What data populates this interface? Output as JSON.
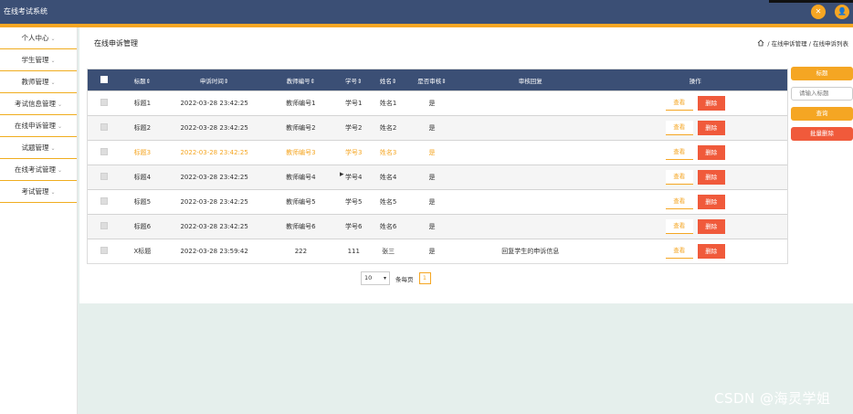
{
  "app": {
    "title": "在线考试系统"
  },
  "header": {
    "close_icon": "close-icon",
    "user_icon": "user-icon"
  },
  "sidebar": {
    "items": [
      {
        "label": "个人中心"
      },
      {
        "label": "学生管理"
      },
      {
        "label": "教师管理"
      },
      {
        "label": "考试信息管理"
      },
      {
        "label": "在线申诉管理"
      },
      {
        "label": "试题管理"
      },
      {
        "label": "在线考试管理"
      },
      {
        "label": "考试管理"
      }
    ]
  },
  "page": {
    "title": "在线申诉管理",
    "breadcrumb": [
      "在线申诉管理",
      "在线申诉列表"
    ],
    "breadcrumb_sep": "/"
  },
  "table": {
    "columns": [
      "标题",
      "申诉时间",
      "教师编号",
      "学号",
      "姓名",
      "是否审核",
      "审核回复",
      "操作"
    ],
    "sort_marker": "⇕",
    "rows": [
      {
        "title": "标题1",
        "time": "2022-03-28 23:42:25",
        "teacher": "教师编号1",
        "student_no": "学号1",
        "name": "姓名1",
        "reviewed": "是",
        "reply": ""
      },
      {
        "title": "标题2",
        "time": "2022-03-28 23:42:25",
        "teacher": "教师编号2",
        "student_no": "学号2",
        "name": "姓名2",
        "reviewed": "是",
        "reply": ""
      },
      {
        "title": "标题3",
        "time": "2022-03-28 23:42:25",
        "teacher": "教师编号3",
        "student_no": "学号3",
        "name": "姓名3",
        "reviewed": "是",
        "reply": ""
      },
      {
        "title": "标题4",
        "time": "2022-03-28 23:42:25",
        "teacher": "教师编号4",
        "student_no": "学号4",
        "name": "姓名4",
        "reviewed": "是",
        "reply": ""
      },
      {
        "title": "标题5",
        "time": "2022-03-28 23:42:25",
        "teacher": "教师编号5",
        "student_no": "学号5",
        "name": "姓名5",
        "reviewed": "是",
        "reply": ""
      },
      {
        "title": "标题6",
        "time": "2022-03-28 23:42:25",
        "teacher": "教师编号6",
        "student_no": "学号6",
        "name": "姓名6",
        "reviewed": "是",
        "reply": ""
      },
      {
        "title": "X标题",
        "time": "2022-03-28 23:59:42",
        "teacher": "222",
        "student_no": "111",
        "name": "张三",
        "reviewed": "是",
        "reply": "回复学生的申诉信息"
      }
    ],
    "actions": {
      "view": "查看",
      "delete": "删除"
    }
  },
  "pagination": {
    "page_size": "10",
    "page_size_label": "条每页",
    "current_page": "1"
  },
  "tools": {
    "label_button": "标题",
    "search_placeholder": "请输入标题",
    "search_button": "查询",
    "batch_delete": "批量删除"
  },
  "watermark": "CSDN @海灵学姐",
  "colors": {
    "header": "#3b4f75",
    "accent": "#f5a623",
    "danger": "#f05a3b"
  }
}
